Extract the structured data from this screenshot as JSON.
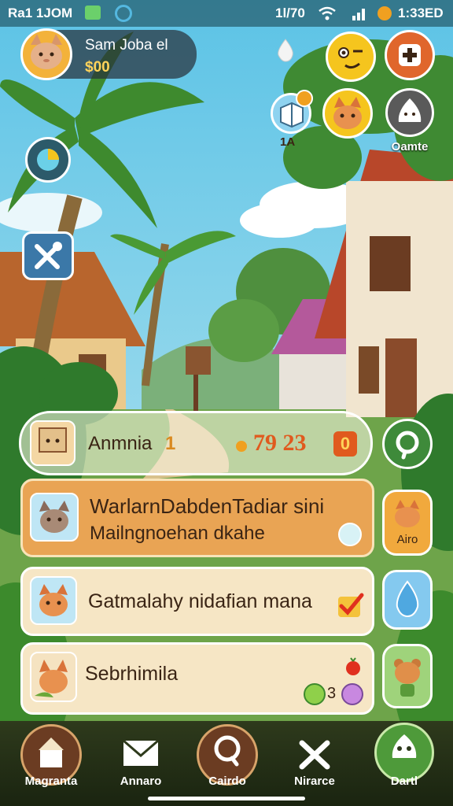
{
  "status_bar": {
    "carrier": "Ra1 1JOM",
    "center": "1l/70",
    "time": "1:33ED"
  },
  "profile": {
    "name": "Sam Joba el",
    "money": "$00"
  },
  "top_right": {
    "small_badge_count": "1A",
    "circle_label": "Oamte"
  },
  "hud": {
    "name": "Anmnia",
    "num": "1",
    "score": "79 23",
    "icon_glyph": "0"
  },
  "quests": [
    {
      "line1": "WarlarnDabdenTadiar sini",
      "line2": "Mailngnoehan dkahe",
      "side_label": "Airo"
    },
    {
      "line1": "Gatmalahy nidafian mana"
    },
    {
      "line1": "Sebrhimila",
      "count": "3"
    }
  ],
  "nav": [
    {
      "label": "Magranta"
    },
    {
      "label": "Annaro"
    },
    {
      "label": "Cairdo"
    },
    {
      "label": "Nirarce"
    },
    {
      "label": "Dartl"
    }
  ],
  "colors": {
    "card_orange": "#e9a454",
    "card_cream": "#f6e6c5",
    "side_orange": "#f1a93d",
    "side_blue": "#84c9ef",
    "side_green": "#9fd37b"
  }
}
